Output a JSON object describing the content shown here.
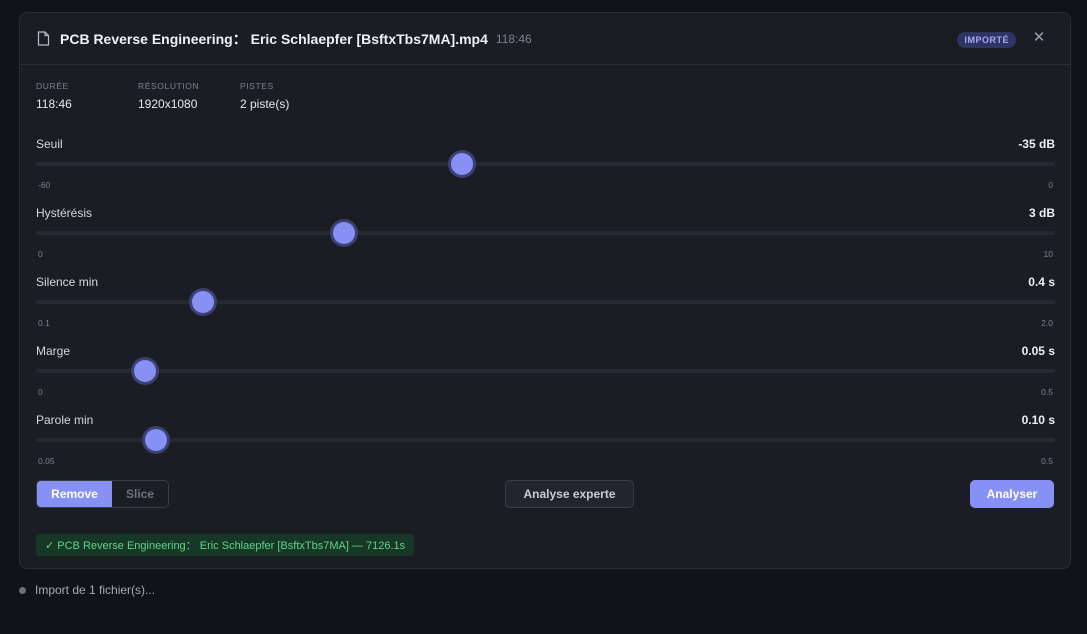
{
  "header": {
    "title": "PCB Reverse Engineering： Eric Schlaepfer [BsftxTbs7MA].mp4",
    "duration": "118:46",
    "badge": "IMPORTÉ",
    "close_icon": "close-icon",
    "file_icon": "file-icon"
  },
  "meta": [
    {
      "label": "DURÉE",
      "value": "118:46"
    },
    {
      "label": "RÉSOLUTION",
      "value": "1920x1080"
    },
    {
      "label": "PISTES",
      "value": "2 piste(s)"
    }
  ],
  "sliders": [
    {
      "label": "Seuil",
      "value": "-35 dB",
      "min": "-60",
      "max": "0",
      "level": 0.4178
    },
    {
      "label": "Hystérésis",
      "value": "3 dB",
      "min": "0",
      "max": "10",
      "level": 0.3027
    },
    {
      "label": "Silence min",
      "value": "0.4 s",
      "min": "0.1",
      "max": "2.0",
      "level": 0.1634
    },
    {
      "label": "Marge",
      "value": "0.05 s",
      "min": "0",
      "max": "0.5",
      "level": 0.1065
    },
    {
      "label": "Parole min",
      "value": "0.10 s",
      "min": "0.05",
      "max": "0.5",
      "level": 0.1173
    }
  ],
  "mode": {
    "options": [
      "Remove",
      "Slice"
    ],
    "selected": "Remove"
  },
  "actions": {
    "expert": "Analyse experte",
    "analyze": "Analyser"
  },
  "result": "✓ PCB Reverse Engineering： Eric Schlaepfer [BsftxTbs7MA] — 7126.1s",
  "status": "Import de 1 fichier(s)...",
  "colors": {
    "accent": "#8690f5",
    "success": "#5fd38c",
    "badge_bg": "#2f3462"
  }
}
